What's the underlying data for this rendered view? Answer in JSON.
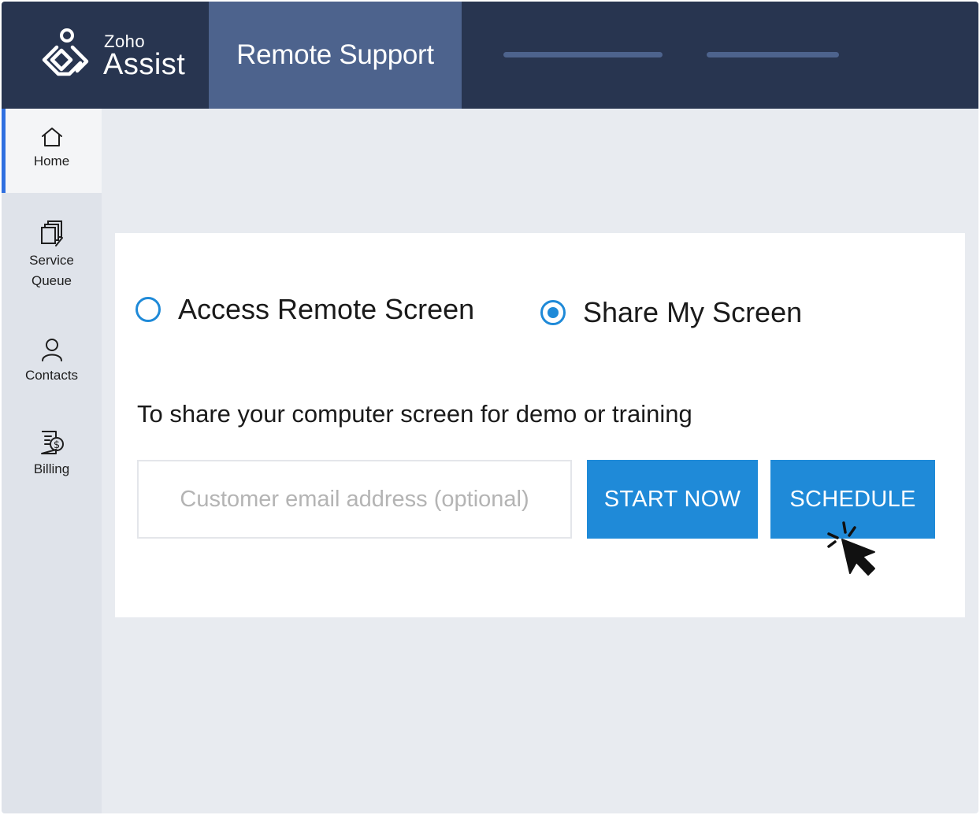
{
  "brand": {
    "company": "Zoho",
    "product": "Assist"
  },
  "header": {
    "active_tab": "Remote Support"
  },
  "sidebar": {
    "items": [
      {
        "label": "Home",
        "icon": "home-icon",
        "active": true
      },
      {
        "label": "Service\nQueue",
        "icon": "service-queue-icon",
        "active": false
      },
      {
        "label": "Contacts",
        "icon": "contacts-icon",
        "active": false
      },
      {
        "label": "Billing",
        "icon": "billing-icon",
        "active": false
      }
    ]
  },
  "session": {
    "options": [
      {
        "label": "Access Remote Screen",
        "selected": false
      },
      {
        "label": "Share My Screen",
        "selected": true
      }
    ],
    "description": "To share your computer screen for demo or training",
    "email_placeholder": "Customer email address (optional)",
    "start_now_label": "START NOW",
    "schedule_label": "SCHEDULE"
  },
  "colors": {
    "header_bg": "#283550",
    "active_tab_bg": "#4d638d",
    "accent_blue": "#1f8ad8",
    "sidebar_active_border": "#2f6fe0",
    "page_bg": "#e8ebf0"
  }
}
